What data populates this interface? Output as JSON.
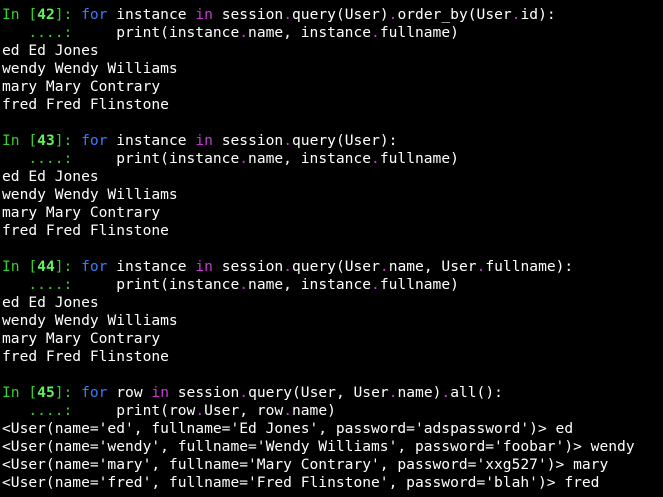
{
  "colors": {
    "background": "#000000",
    "text": "#ffffff",
    "prompt": "#36d02f",
    "keyword": "#3b79ff",
    "operator": "#c73ad2"
  },
  "cells": [
    {
      "prompt_in": "In [",
      "prompt_num": "42",
      "prompt_close": "]:",
      "code_line1": [
        {
          "t": " ",
          "c": "plain"
        },
        {
          "t": "for",
          "c": "kw"
        },
        {
          "t": " instance ",
          "c": "plain"
        },
        {
          "t": "in",
          "c": "op"
        },
        {
          "t": " session",
          "c": "plain"
        },
        {
          "t": ".",
          "c": "dot"
        },
        {
          "t": "query(User)",
          "c": "plain"
        },
        {
          "t": ".",
          "c": "dot"
        },
        {
          "t": "order_by(User",
          "c": "plain"
        },
        {
          "t": ".",
          "c": "dot"
        },
        {
          "t": "id):",
          "c": "plain"
        }
      ],
      "cont_prompt": "   ....:",
      "code_line2": [
        {
          "t": "     print(instance",
          "c": "plain"
        },
        {
          "t": ".",
          "c": "dot"
        },
        {
          "t": "name, instance",
          "c": "plain"
        },
        {
          "t": ".",
          "c": "dot"
        },
        {
          "t": "fullname)",
          "c": "plain"
        }
      ],
      "output": [
        "ed Ed Jones",
        "wendy Wendy Williams",
        "mary Mary Contrary",
        "fred Fred Flinstone"
      ]
    },
    {
      "prompt_in": "In [",
      "prompt_num": "43",
      "prompt_close": "]:",
      "code_line1": [
        {
          "t": " ",
          "c": "plain"
        },
        {
          "t": "for",
          "c": "kw"
        },
        {
          "t": " instance ",
          "c": "plain"
        },
        {
          "t": "in",
          "c": "op"
        },
        {
          "t": " session",
          "c": "plain"
        },
        {
          "t": ".",
          "c": "dot"
        },
        {
          "t": "query(User):",
          "c": "plain"
        }
      ],
      "cont_prompt": "   ....:",
      "code_line2": [
        {
          "t": "     print(instance",
          "c": "plain"
        },
        {
          "t": ".",
          "c": "dot"
        },
        {
          "t": "name, instance",
          "c": "plain"
        },
        {
          "t": ".",
          "c": "dot"
        },
        {
          "t": "fullname)",
          "c": "plain"
        }
      ],
      "output": [
        "ed Ed Jones",
        "wendy Wendy Williams",
        "mary Mary Contrary",
        "fred Fred Flinstone"
      ]
    },
    {
      "prompt_in": "In [",
      "prompt_num": "44",
      "prompt_close": "]:",
      "code_line1": [
        {
          "t": " ",
          "c": "plain"
        },
        {
          "t": "for",
          "c": "kw"
        },
        {
          "t": " instance ",
          "c": "plain"
        },
        {
          "t": "in",
          "c": "op"
        },
        {
          "t": " session",
          "c": "plain"
        },
        {
          "t": ".",
          "c": "dot"
        },
        {
          "t": "query(User",
          "c": "plain"
        },
        {
          "t": ".",
          "c": "dot"
        },
        {
          "t": "name, User",
          "c": "plain"
        },
        {
          "t": ".",
          "c": "dot"
        },
        {
          "t": "fullname):",
          "c": "plain"
        }
      ],
      "cont_prompt": "   ....:",
      "code_line2": [
        {
          "t": "     print(instance",
          "c": "plain"
        },
        {
          "t": ".",
          "c": "dot"
        },
        {
          "t": "name, instance",
          "c": "plain"
        },
        {
          "t": ".",
          "c": "dot"
        },
        {
          "t": "fullname)",
          "c": "plain"
        }
      ],
      "output": [
        "ed Ed Jones",
        "wendy Wendy Williams",
        "mary Mary Contrary",
        "fred Fred Flinstone"
      ]
    },
    {
      "prompt_in": "In [",
      "prompt_num": "45",
      "prompt_close": "]:",
      "code_line1": [
        {
          "t": " ",
          "c": "plain"
        },
        {
          "t": "for",
          "c": "kw"
        },
        {
          "t": " row ",
          "c": "plain"
        },
        {
          "t": "in",
          "c": "op"
        },
        {
          "t": " session",
          "c": "plain"
        },
        {
          "t": ".",
          "c": "dot"
        },
        {
          "t": "query(User, User",
          "c": "plain"
        },
        {
          "t": ".",
          "c": "dot"
        },
        {
          "t": "name)",
          "c": "plain"
        },
        {
          "t": ".",
          "c": "dot"
        },
        {
          "t": "all():",
          "c": "plain"
        }
      ],
      "cont_prompt": "   ....:",
      "code_line2": [
        {
          "t": "     print(row",
          "c": "plain"
        },
        {
          "t": ".",
          "c": "dot"
        },
        {
          "t": "User, row",
          "c": "plain"
        },
        {
          "t": ".",
          "c": "dot"
        },
        {
          "t": "name)",
          "c": "plain"
        }
      ],
      "output": [
        "<User(name='ed', fullname='Ed Jones', password='adspassword')> ed",
        "<User(name='wendy', fullname='Wendy Williams', password='foobar')> wendy",
        "<User(name='mary', fullname='Mary Contrary', password='xxg527')> mary",
        "<User(name='fred', fullname='Fred Flinstone', password='blah')> fred"
      ]
    }
  ]
}
